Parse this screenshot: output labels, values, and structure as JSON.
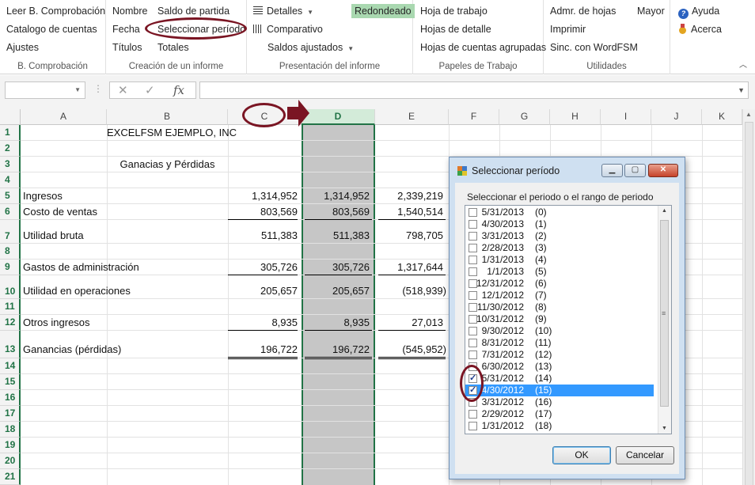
{
  "ribbon": {
    "groups": [
      {
        "title": "B. Comprobación",
        "items": [
          "Leer B. Comprobación",
          "Catalogo de cuentas",
          "Ajustes"
        ]
      },
      {
        "title": "Creación de un informe",
        "items": [
          "Nombre",
          "Saldo de partida",
          "Fecha",
          "Seleccionar período",
          "Títulos",
          "Totales"
        ]
      },
      {
        "title": "Presentación del informe",
        "items": [
          "Detalles",
          "Redondeado",
          "Comparativo",
          "Saldos ajustados"
        ]
      },
      {
        "title": "Papeles de Trabajo",
        "items": [
          "Hoja de trabajo",
          "Hojas de detalle",
          "Hojas de cuentas agrupadas"
        ]
      },
      {
        "title": "Utilidades",
        "items": [
          "Admr. de hojas",
          "Mayor",
          "Imprimir",
          "Sinc. con WordFSM"
        ]
      },
      {
        "title": "",
        "items": [
          "Ayuda",
          "Acerca"
        ]
      }
    ]
  },
  "formula_bar": {
    "name_box": "",
    "fx_label": "fx",
    "cancel": "✕",
    "confirm": "✓",
    "content": ""
  },
  "columns": [
    "A",
    "B",
    "C",
    "D",
    "E",
    "F",
    "G",
    "H",
    "I",
    "J",
    "K"
  ],
  "rows": [
    "1",
    "2",
    "3",
    "4",
    "5",
    "6",
    "7",
    "8",
    "9",
    "10",
    "11",
    "12",
    "13",
    "14",
    "15",
    "16",
    "17",
    "18",
    "19",
    "20",
    "21"
  ],
  "sheet": {
    "company": "EXCELFSM EJEMPLO, INC",
    "title": "Ganacias y Pérdidas",
    "lines": [
      {
        "label": "Ingresos",
        "c": "1,314,952",
        "d": "1,314,952",
        "e": "2,339,219"
      },
      {
        "label": "Costo de ventas",
        "c": "803,569",
        "d": "803,569",
        "e": "1,540,514"
      },
      {
        "label": "Utilidad bruta",
        "c": "511,383",
        "d": "511,383",
        "e": "798,705"
      },
      {
        "label": "Gastos de administración",
        "c": "305,726",
        "d": "305,726",
        "e": "1,317,644"
      },
      {
        "label": "Utilidad en operaciones",
        "c": "205,657",
        "d": "205,657",
        "e": "(518,939)"
      },
      {
        "label": "Otros ingresos",
        "c": "8,935",
        "d": "8,935",
        "e": "27,013"
      },
      {
        "label": "Ganancias (pérdidas)",
        "c": "196,722",
        "d": "196,722",
        "e": "(545,952)"
      }
    ]
  },
  "dialog": {
    "title": "Seleccionar período",
    "prompt": "Seleccionar el periodo o el rango de periodo",
    "periods": [
      {
        "date": "5/31/2013",
        "idx": "(0)",
        "checked": false
      },
      {
        "date": "4/30/2013",
        "idx": "(1)",
        "checked": false
      },
      {
        "date": "3/31/2013",
        "idx": "(2)",
        "checked": false
      },
      {
        "date": "2/28/2013",
        "idx": "(3)",
        "checked": false
      },
      {
        "date": "1/31/2013",
        "idx": "(4)",
        "checked": false
      },
      {
        "date": "1/1/2013",
        "idx": "(5)",
        "checked": false
      },
      {
        "date": "12/31/2012",
        "idx": "(6)",
        "checked": false
      },
      {
        "date": "12/1/2012",
        "idx": "(7)",
        "checked": false
      },
      {
        "date": "11/30/2012",
        "idx": "(8)",
        "checked": false
      },
      {
        "date": "10/31/2012",
        "idx": "(9)",
        "checked": false
      },
      {
        "date": "9/30/2012",
        "idx": "(10)",
        "checked": false
      },
      {
        "date": "8/31/2012",
        "idx": "(11)",
        "checked": false
      },
      {
        "date": "7/31/2012",
        "idx": "(12)",
        "checked": false
      },
      {
        "date": "6/30/2012",
        "idx": "(13)",
        "checked": false
      },
      {
        "date": "5/31/2012",
        "idx": "(14)",
        "checked": true
      },
      {
        "date": "4/30/2012",
        "idx": "(15)",
        "checked": true,
        "selected": true
      },
      {
        "date": "3/31/2012",
        "idx": "(16)",
        "checked": false
      },
      {
        "date": "2/29/2012",
        "idx": "(17)",
        "checked": false
      },
      {
        "date": "1/31/2012",
        "idx": "(18)",
        "checked": false
      }
    ],
    "ok": "OK",
    "cancel": "Cancelar"
  },
  "colors": {
    "excel_green": "#217346",
    "annotation": "#7a1523",
    "selection_blue": "#3399ff"
  }
}
